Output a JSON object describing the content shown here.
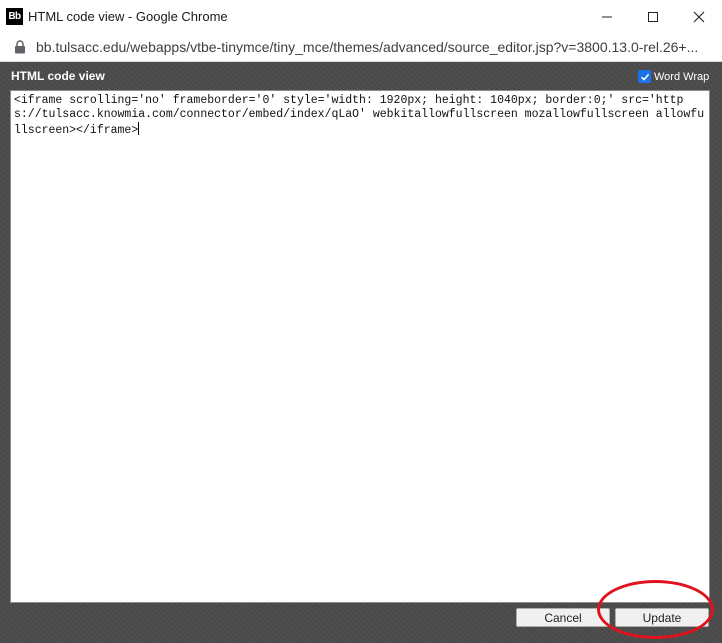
{
  "window": {
    "app_icon_text": "Bb",
    "title": "HTML code view - Google Chrome"
  },
  "address_bar": {
    "url": "bb.tulsacc.edu/webapps/vtbe-tinymce/tiny_mce/themes/advanced/source_editor.jsp?v=3800.13.0-rel.26+..."
  },
  "dialog": {
    "title": "HTML code view",
    "word_wrap": {
      "label": "Word Wrap",
      "checked": true
    },
    "code": "<iframe scrolling='no' frameborder='0' style='width: 1920px; height: 1040px; border:0;' src='https://tulsacc.knowmia.com/connector/embed/index/qLaO' webkitallowfullscreen mozallowfullscreen allowfullscreen></iframe>",
    "buttons": {
      "cancel": "Cancel",
      "update": "Update"
    }
  },
  "colors": {
    "dialog_bg": "#4b4b4b",
    "checkbox_accent": "#1a73e8",
    "annotation_circle": "#e0121d"
  },
  "icons": [
    "app-icon",
    "minimize-icon",
    "maximize-icon",
    "close-icon",
    "lock-icon",
    "checkmark-icon"
  ]
}
